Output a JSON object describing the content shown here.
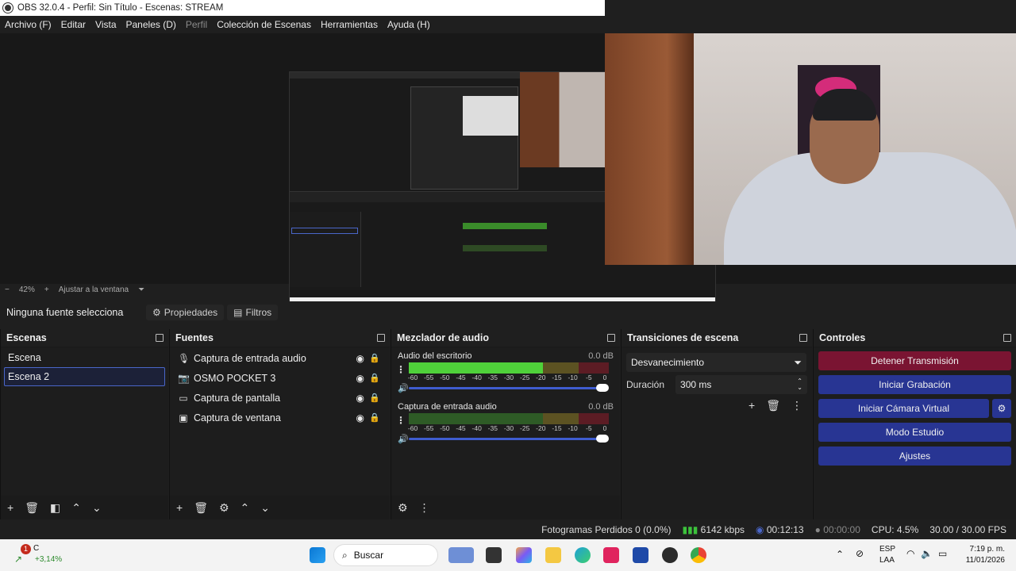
{
  "window": {
    "title": "OBS 32.0.4 - Perfil: Sin Título - Escenas: STREAM"
  },
  "menu": [
    "Archivo (F)",
    "Editar",
    "Vista",
    "Paneles (D)",
    "Perfil",
    "Colección de Escenas",
    "Herramientas",
    "Ayuda (H)"
  ],
  "zoom": {
    "value": "42%",
    "fit_label": "Ajustar a la ventana"
  },
  "source_bar": {
    "no_source": "Ninguna fuente selecciona",
    "properties": "Propiedades",
    "filters": "Filtros"
  },
  "scenes": {
    "title": "Escenas",
    "items": [
      "Escena",
      "Escena 2"
    ],
    "selected": "Escena 2"
  },
  "sources": {
    "title": "Fuentes",
    "items": [
      {
        "name": "Captura de entrada audio",
        "icon": "microphone-icon"
      },
      {
        "name": "OSMO POCKET 3",
        "icon": "camera-icon"
      },
      {
        "name": "Captura de pantalla",
        "icon": "monitor-icon"
      },
      {
        "name": "Captura de ventana",
        "icon": "window-icon"
      }
    ]
  },
  "mixer": {
    "title": "Mezclador de audio",
    "channels": [
      {
        "name": "Audio del escritorio",
        "db": "0.0 dB",
        "level": 0.67
      },
      {
        "name": "Captura de entrada audio",
        "db": "0.0 dB",
        "level": 0.0
      }
    ],
    "scale": [
      "-60",
      "-55",
      "-50",
      "-45",
      "-40",
      "-35",
      "-30",
      "-25",
      "-20",
      "-15",
      "-10",
      "-5",
      "0"
    ]
  },
  "transitions": {
    "title": "Transiciones de escena",
    "selected": "Desvanecimiento",
    "duration_label": "Duración",
    "duration": "300 ms"
  },
  "controls": {
    "title": "Controles",
    "stop_stream": "Detener Transmisión",
    "start_record": "Iniciar Grabación",
    "virtual_cam": "Iniciar Cámara Virtual",
    "studio_mode": "Modo Estudio",
    "settings": "Ajustes"
  },
  "status": {
    "dropped": "Fotogramas Perdidos 0 (0.0%)",
    "bitrate": "6142 kbps",
    "stream_time": "00:12:13",
    "rec_time": "00:00:00",
    "cpu": "CPU: 4.5%",
    "fps": "30.00 / 30.00 FPS"
  },
  "taskbar": {
    "weather_temp": "C",
    "weather_change": "+3,14%",
    "weather_badge": "1",
    "search": "Buscar",
    "lang": "ESP",
    "layout": "LAA",
    "time": "7:19 p. m.",
    "date": "11/01/2026"
  },
  "colors": {
    "accent_blue": "#283593",
    "stop_red": "#7a1432",
    "meter_green": "#4fd13a"
  }
}
